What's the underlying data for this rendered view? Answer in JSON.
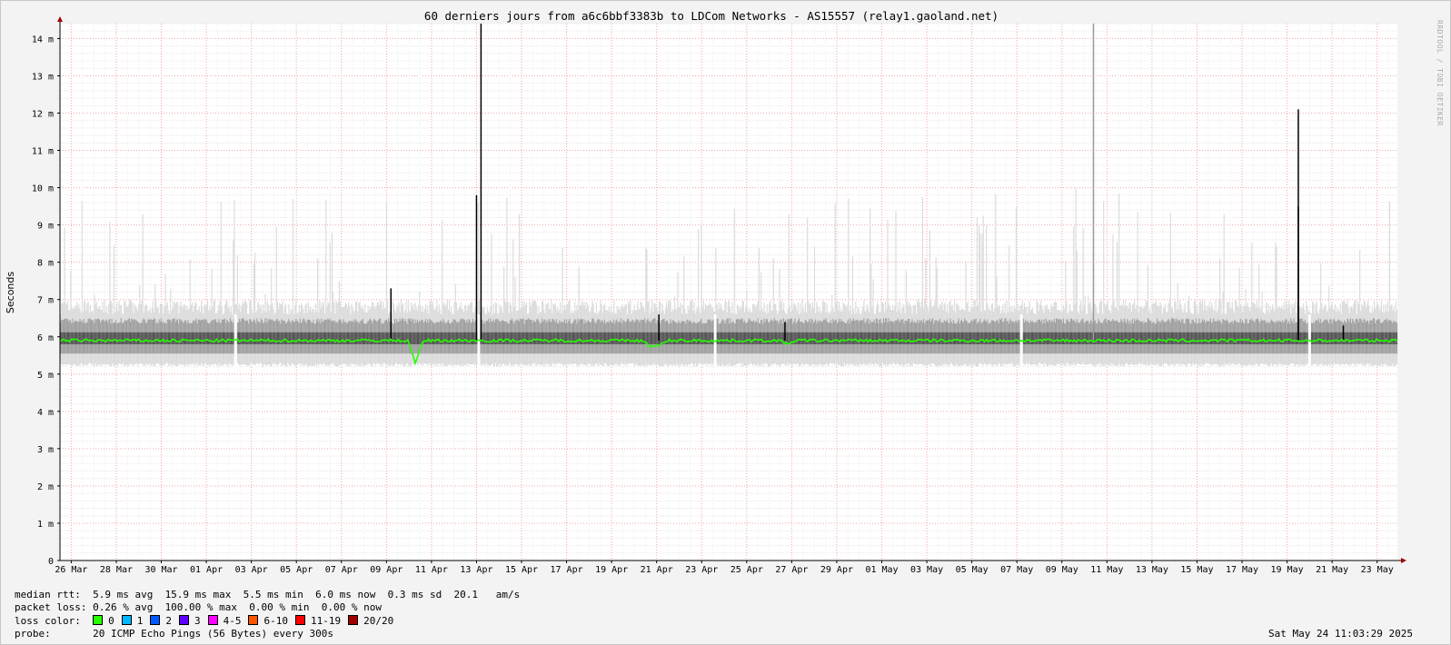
{
  "chart_data": {
    "type": "area",
    "title": "60 derniers jours from a6c6bbf3383b to LDCom Networks - AS15557 (relay1.gaoland.net)",
    "ylabel": "Seconds",
    "ylim": [
      0,
      14.4
    ],
    "y_unit": "ms",
    "y_ticks": [
      {
        "value": 0,
        "label": "0"
      },
      {
        "value": 1,
        "label": "1 m"
      },
      {
        "value": 2,
        "label": "2 m"
      },
      {
        "value": 3,
        "label": "3 m"
      },
      {
        "value": 4,
        "label": "4 m"
      },
      {
        "value": 5,
        "label": "5 m"
      },
      {
        "value": 6,
        "label": "6 m"
      },
      {
        "value": 7,
        "label": "7 m"
      },
      {
        "value": 8,
        "label": "8 m"
      },
      {
        "value": 9,
        "label": "9 m"
      },
      {
        "value": 10,
        "label": "10 m"
      },
      {
        "value": 11,
        "label": "11 m"
      },
      {
        "value": 12,
        "label": "12 m"
      },
      {
        "value": 13,
        "label": "13 m"
      },
      {
        "value": 14,
        "label": "14 m"
      }
    ],
    "x_ticks": [
      "26 Mar",
      "28 Mar",
      "30 Mar",
      "01 Apr",
      "03 Apr",
      "05 Apr",
      "07 Apr",
      "09 Apr",
      "11 Apr",
      "13 Apr",
      "15 Apr",
      "17 Apr",
      "19 Apr",
      "21 Apr",
      "23 Apr",
      "25 Apr",
      "27 Apr",
      "29 Apr",
      "01 May",
      "03 May",
      "05 May",
      "07 May",
      "09 May",
      "11 May",
      "13 May",
      "15 May",
      "17 May",
      "19 May",
      "21 May",
      "23 May"
    ],
    "x_range_days": [
      -0.5,
      58.9
    ],
    "grid": true,
    "median_rtt_ms": {
      "baseline": 5.9,
      "deviations": [
        {
          "day": 15.3,
          "value": 5.3
        },
        {
          "day": 25.6,
          "value": 5.8
        },
        {
          "day": 25.9,
          "value": 5.75
        },
        {
          "day": 26.2,
          "value": 5.8
        },
        {
          "day": 31.8,
          "value": 5.8
        }
      ]
    },
    "rtt_band_ms": {
      "min": 5.3,
      "max": 6.6
    },
    "spikes_ms": [
      {
        "day": 14.2,
        "value": 7.3
      },
      {
        "day": 18.2,
        "value": 14.4
      },
      {
        "day": 18.0,
        "value": 9.8
      },
      {
        "day": 26.1,
        "value": 6.6
      },
      {
        "day": 31.7,
        "value": 6.4
      },
      {
        "day": 45.4,
        "value": 14.4
      },
      {
        "day": 54.5,
        "value": 9.5
      },
      {
        "day": 54.5,
        "value": 12.1
      },
      {
        "day": 56.5,
        "value": 6.3
      }
    ],
    "gaps": [
      7.3,
      18.1,
      28.6,
      42.2,
      55.0
    ]
  },
  "stats": {
    "median_rtt": "median rtt:  5.9 ms avg  15.9 ms max  5.5 ms min  6.0 ms now  0.3 ms sd  20.1   am/s",
    "packet_loss": "packet loss: 0.26 % avg  100.00 % max  0.00 % min  0.00 % now",
    "loss_color_label": "loss color:",
    "probe": "probe:       20 ICMP Echo Pings (56 Bytes) every 300s",
    "timestamp": "Sat May 24 11:03:29 2025",
    "watermark": "RRDTOOL / TOBI OETIKER"
  },
  "loss_colors": [
    {
      "label": "0",
      "color": "#26ff00"
    },
    {
      "label": "1",
      "color": "#00b8ff"
    },
    {
      "label": "2",
      "color": "#0059ff"
    },
    {
      "label": "3",
      "color": "#5e00ff"
    },
    {
      "label": "4-5",
      "color": "#ff00ff"
    },
    {
      "label": "6-10",
      "color": "#ff5500"
    },
    {
      "label": "11-19",
      "color": "#ff0000"
    },
    {
      "label": "20/20",
      "color": "#a10000"
    }
  ]
}
